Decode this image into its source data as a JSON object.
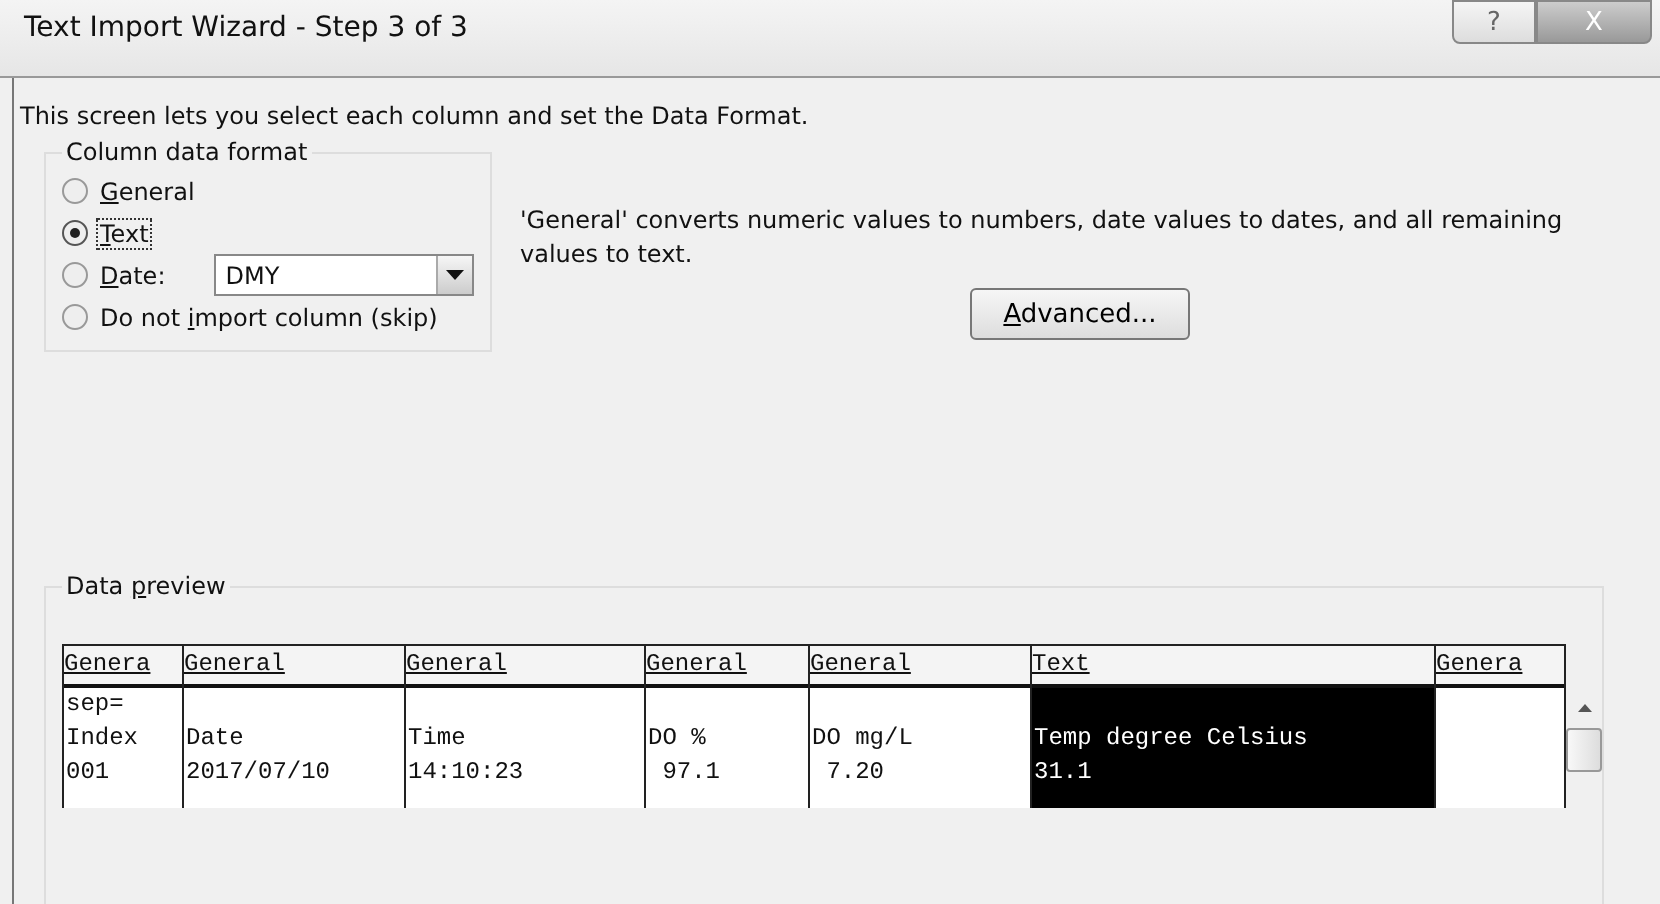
{
  "window": {
    "title": "Text Import Wizard - Step 3 of 3",
    "buttons": [
      {
        "kind": "help",
        "label": "?"
      },
      {
        "kind": "close",
        "label": "X"
      }
    ]
  },
  "intro": "This screen lets you select each column and set the Data Format.",
  "column_format": {
    "title": "Column data format",
    "options": [
      {
        "kind": "plain",
        "label": "General",
        "selected": false
      },
      {
        "kind": "plain",
        "label": "Text",
        "selected": true,
        "focused": true
      },
      {
        "kind": "dropdown",
        "label": "Date:",
        "selected": false,
        "value": "DMY"
      },
      {
        "kind": "plain",
        "label": "Do not import column (skip)",
        "selected": false
      }
    ]
  },
  "description": "'General' converts numeric values to numbers, date values to dates, and all remaining values to text.",
  "advanced_button": {
    "label": "Advanced..."
  },
  "preview": {
    "title": "Data preview",
    "columns": [
      {
        "format": "Genera",
        "selected": false,
        "cells": [
          "sep=",
          "Index",
          "001"
        ]
      },
      {
        "format": "General",
        "selected": false,
        "cells": [
          "",
          "Date",
          "2017/07/10"
        ]
      },
      {
        "format": "General",
        "selected": false,
        "cells": [
          "",
          "Time",
          "14:10:23"
        ]
      },
      {
        "format": "General",
        "selected": false,
        "cells": [
          "",
          "DO %",
          " 97.1"
        ]
      },
      {
        "format": "General",
        "selected": false,
        "cells": [
          "",
          "DO mg/L",
          " 7.20"
        ]
      },
      {
        "format": "Text",
        "selected": true,
        "cells": [
          "",
          "Temp degree Celsius",
          "31.1"
        ]
      },
      {
        "format": "Genera",
        "selected": false,
        "cells": [
          "",
          "",
          ""
        ]
      }
    ]
  }
}
